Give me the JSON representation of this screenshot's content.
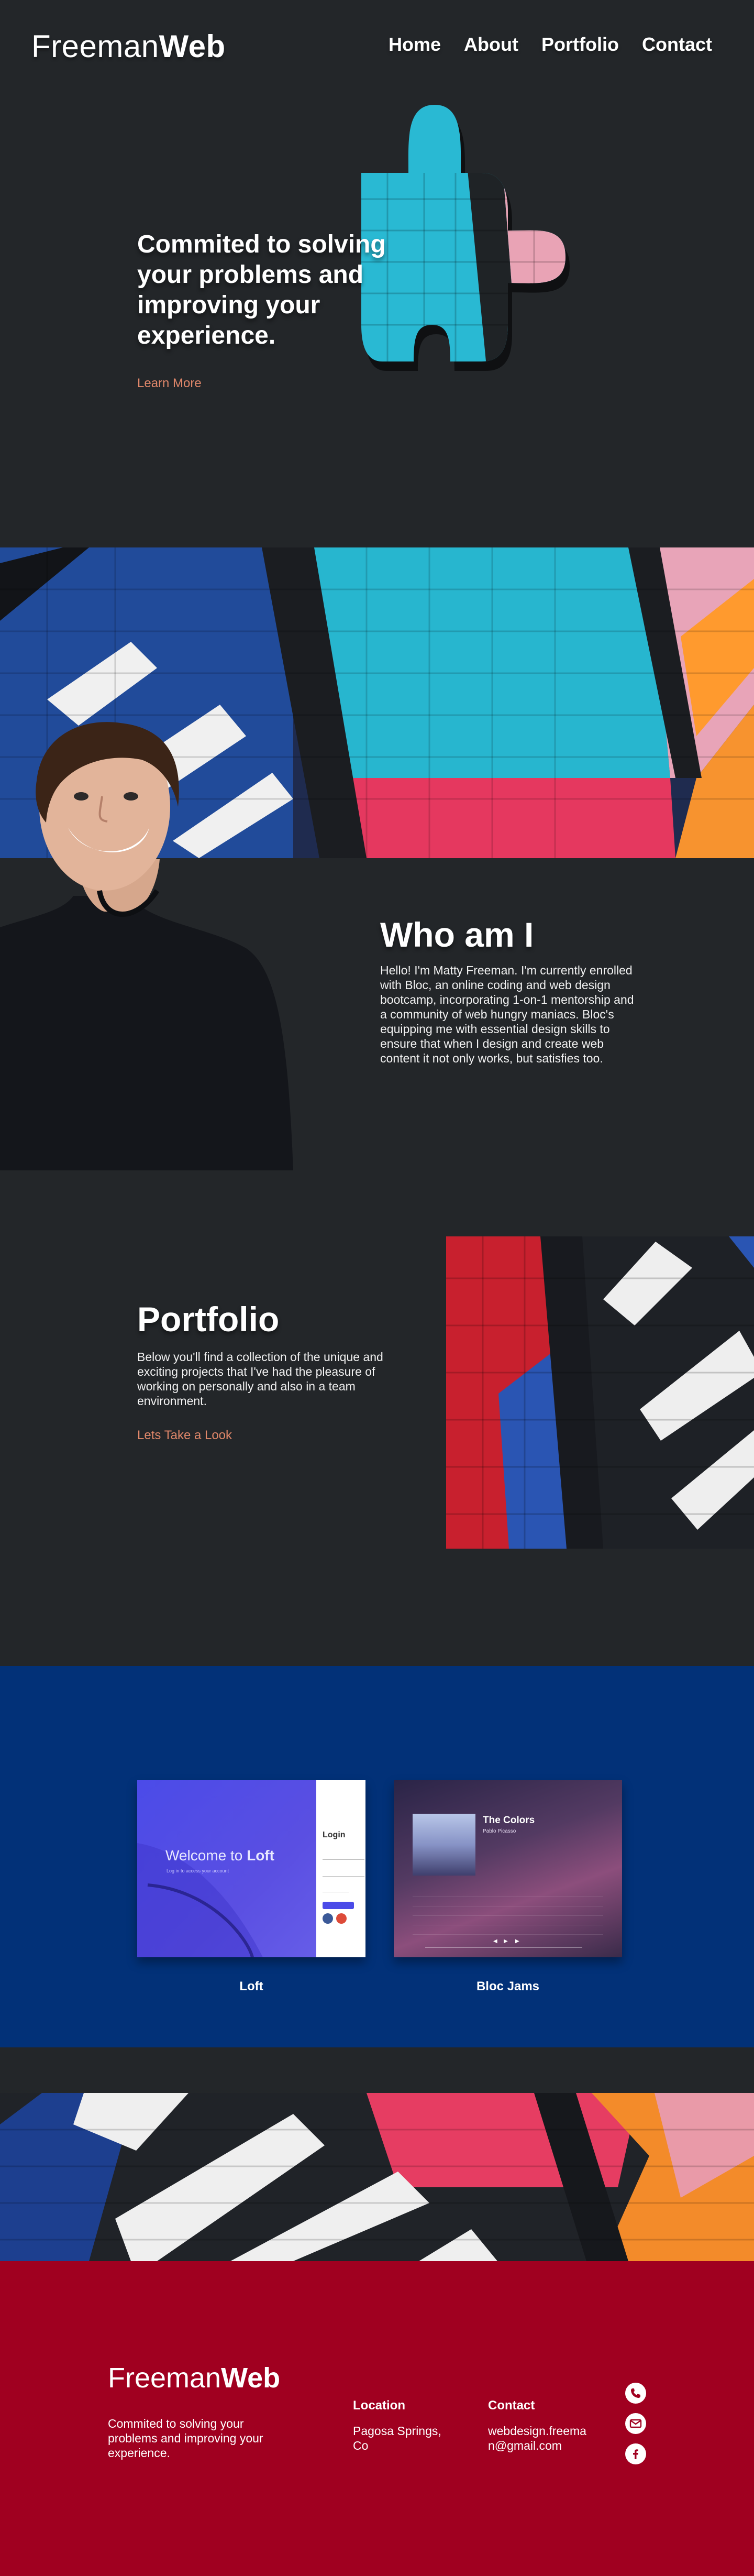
{
  "brand": {
    "name_light": "Freeman",
    "name_bold": "Web"
  },
  "nav": {
    "home": "Home",
    "about": "About",
    "portfolio": "Portfolio",
    "contact": "Contact"
  },
  "hero": {
    "heading": "Commited to solving your problems and improving your experience.",
    "link": "Learn More"
  },
  "who": {
    "title": "Who am I",
    "body": "Hello! I'm Matty Freeman. I'm currently enrolled with Bloc, an online coding and web design bootcamp, incorporating 1-on-1 mentorship and a community of web hungry maniacs. Bloc's equipping me with essential design skills to ensure that when I design and create web content it not only works, but satisfies too."
  },
  "portfolio": {
    "title": "Portfolio",
    "body": "Below you'll find a collection of the unique and exciting projects that I've had the pleasure of working on personally and also in a team environment.",
    "link": "Lets Take a Look"
  },
  "projects": [
    {
      "caption": "Loft",
      "welcome_text": "Welcome to ",
      "welcome_bold": "Loft",
      "sub": "Log in to access your account",
      "login": "Login"
    },
    {
      "caption": "Bloc Jams",
      "album": "The Colors",
      "artist": "Pablo Picasso"
    }
  ],
  "footer": {
    "tagline": "Commited to solving your problems and improving your experience.",
    "location_heading": "Location",
    "location_value": "Pagosa Springs, Co",
    "contact_heading": "Contact",
    "contact_value": "webdesign.freeman@gmail.com",
    "icons": [
      "phone-icon",
      "email-icon",
      "facebook-icon"
    ]
  },
  "colors": {
    "background": "#232629",
    "accent_link": "#e0876a",
    "projects_bg": "#023178",
    "footer_bg": "#a00020"
  }
}
